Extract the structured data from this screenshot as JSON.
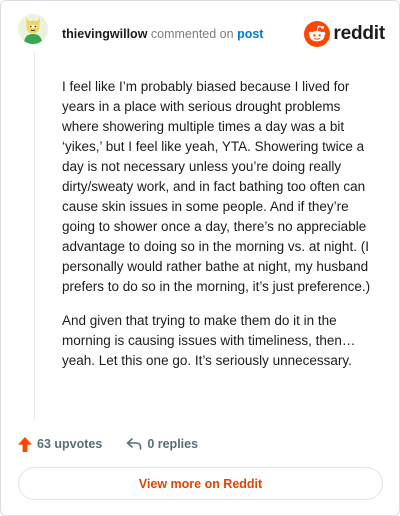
{
  "header": {
    "username": "thievingwillow",
    "action_text": "commented on",
    "post_link": "post",
    "brand_name": "reddit"
  },
  "comment": {
    "paragraphs": [
      "I feel like I’m probably biased because I lived for years in a place with serious drought problems where showering multiple times a day was a bit ‘yikes,’ but I feel like yeah, YTA. Showering twice a day is not necessary unless you’re doing really dirty/sweaty work, and in fact bathing too often can cause skin issues in some people. And if they’re going to shower once a day, there’s no appreciable advantage to doing so in the morning vs. at night. (I personally would rather bathe at night, my husband prefers to do so in the morning, it’s just preference.)",
      "And given that trying to make them do it in the morning is causing issues with timeliness, then… yeah. Let this one go. It’s seriously unnecessary."
    ]
  },
  "footer": {
    "upvotes": "63 upvotes",
    "replies": "0 replies",
    "view_more": "View more on Reddit"
  },
  "colors": {
    "brand_orange": "#ff4500",
    "link_blue": "#0079d3",
    "cta_text": "#e34400"
  },
  "icons": [
    "user-avatar",
    "reddit-snoo-icon",
    "upvote-arrow-icon",
    "reply-arrow-icon"
  ]
}
